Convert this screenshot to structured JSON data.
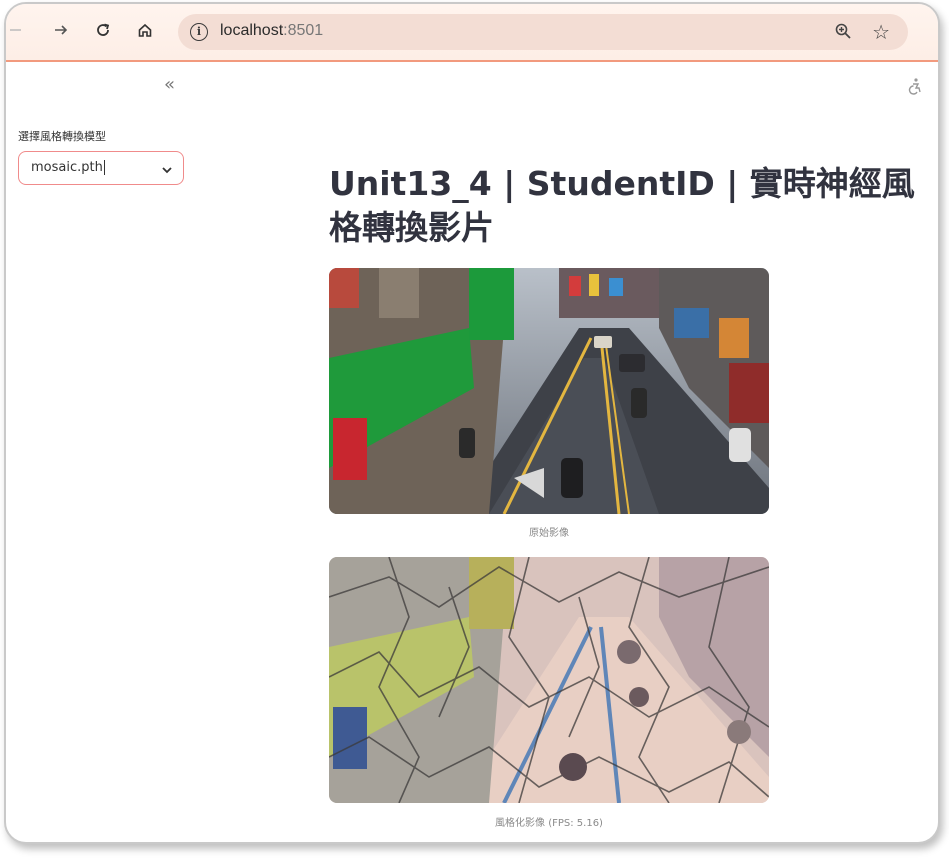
{
  "browser": {
    "url_host": "localhost",
    "url_port": ":8501",
    "back_icon": "back-arrow-icon",
    "forward_icon": "forward-arrow-icon",
    "reload_icon": "reload-icon",
    "home_icon": "home-icon",
    "info_icon": "site-info-icon",
    "zoom_icon": "zoom-icon",
    "star_icon": "bookmark-star-icon",
    "accent_color": "#f29a7e"
  },
  "sidebar": {
    "collapse_label": "«",
    "select_label": "選擇風格轉換模型",
    "select_value": "mosaic.pth"
  },
  "main": {
    "title": "Unit13_4 | StudentID | 實時神經風格轉換影片",
    "original_caption": "原始影像",
    "styled_caption": "風格化影像 (FPS: 5.16)"
  }
}
